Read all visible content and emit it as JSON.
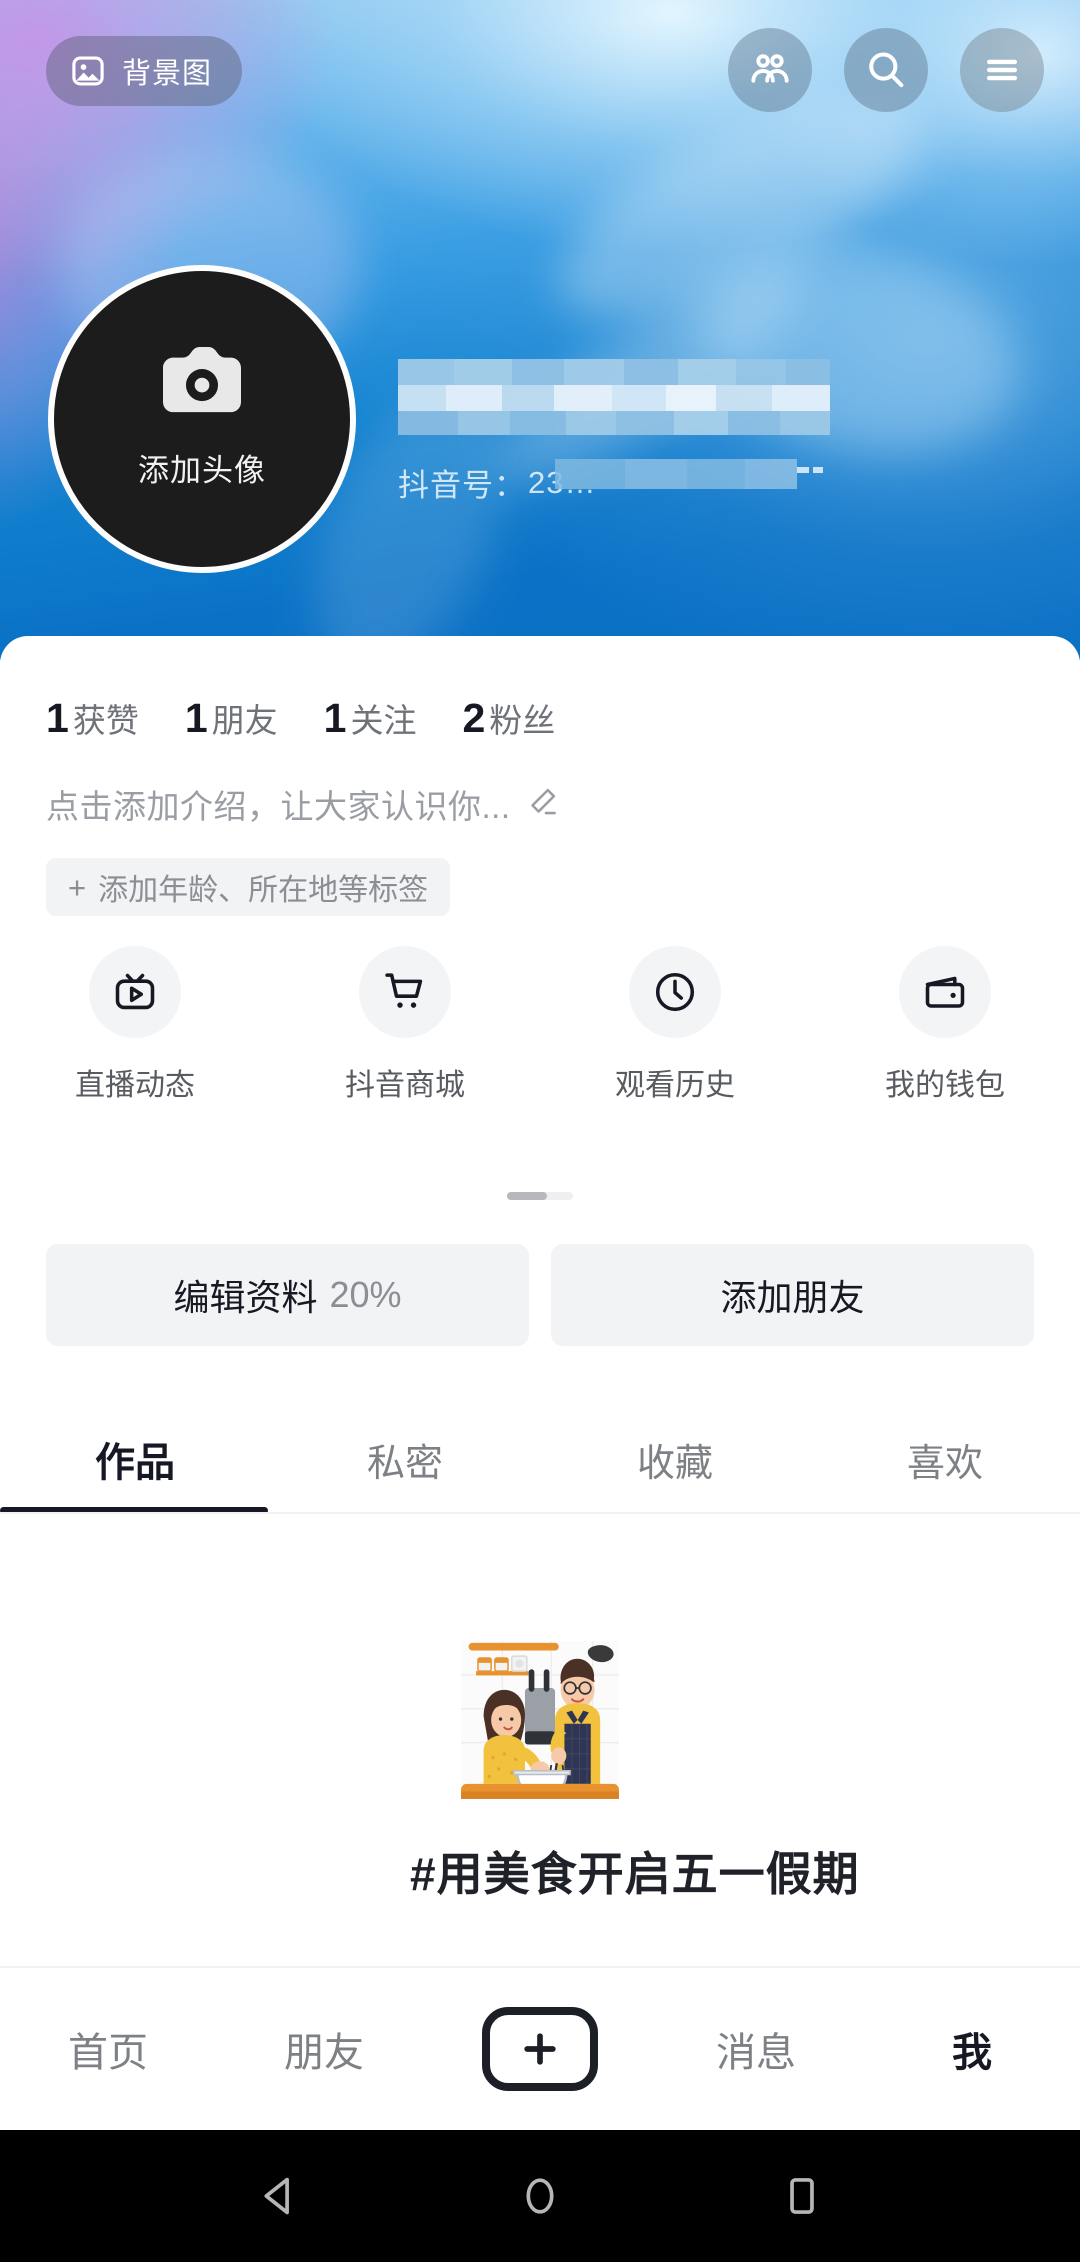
{
  "header": {
    "cover_button": {
      "label": "背景图",
      "icon": "image-icon"
    },
    "actions": [
      {
        "name": "friends",
        "icon": "people-icon"
      },
      {
        "name": "search",
        "icon": "search-icon"
      },
      {
        "name": "menu",
        "icon": "hamburger-icon"
      }
    ],
    "avatar": {
      "add_label": "添加头像",
      "icon": "camera-icon"
    },
    "nickname": "",
    "douyin_id_label": "抖音号：",
    "douyin_id_value": "23…",
    "cover_gradient_colors": [
      "#c496e8",
      "#9fd0f2",
      "#3a9ee3",
      "#0a6fc3"
    ]
  },
  "profile": {
    "stats": [
      {
        "num": "1",
        "label": "获赞"
      },
      {
        "num": "1",
        "label": "朋友"
      },
      {
        "num": "1",
        "label": "关注"
      },
      {
        "num": "2",
        "label": "粉丝"
      }
    ],
    "bio_placeholder": "点击添加介绍，让大家认识你...",
    "bio_edit_icon": "pencil-icon",
    "tag_chip": {
      "plus": "+",
      "label": "添加年龄、所在地等标签"
    },
    "quick_entries": [
      {
        "label": "直播动态",
        "icon": "live-tv-icon"
      },
      {
        "label": "抖音商城",
        "icon": "cart-icon"
      },
      {
        "label": "观看历史",
        "icon": "clock-icon"
      },
      {
        "label": "我的钱包",
        "icon": "wallet-icon"
      }
    ],
    "actions": [
      {
        "label": "编辑资料",
        "suffix": "20%"
      },
      {
        "label": "添加朋友",
        "suffix": ""
      }
    ]
  },
  "tabs": {
    "items": [
      {
        "label": "作品",
        "active": true
      },
      {
        "label": "私密",
        "active": false
      },
      {
        "label": "收藏",
        "active": false
      },
      {
        "label": "喜欢",
        "active": false
      }
    ]
  },
  "content": {
    "banner_title": "#用美食开启五一假期",
    "banner_illustration": "kitchen-cooking-illustration"
  },
  "bottom_nav": [
    {
      "label": "首页",
      "active": false
    },
    {
      "label": "朋友",
      "active": false
    },
    {
      "label": "",
      "active": false,
      "icon": "plus-icon"
    },
    {
      "label": "消息",
      "active": false
    },
    {
      "label": "我",
      "active": true
    }
  ],
  "system_nav": [
    {
      "name": "back",
      "icon": "triangle-back-icon"
    },
    {
      "name": "home",
      "icon": "circle-home-icon"
    },
    {
      "name": "recents",
      "icon": "square-recents-icon"
    }
  ]
}
